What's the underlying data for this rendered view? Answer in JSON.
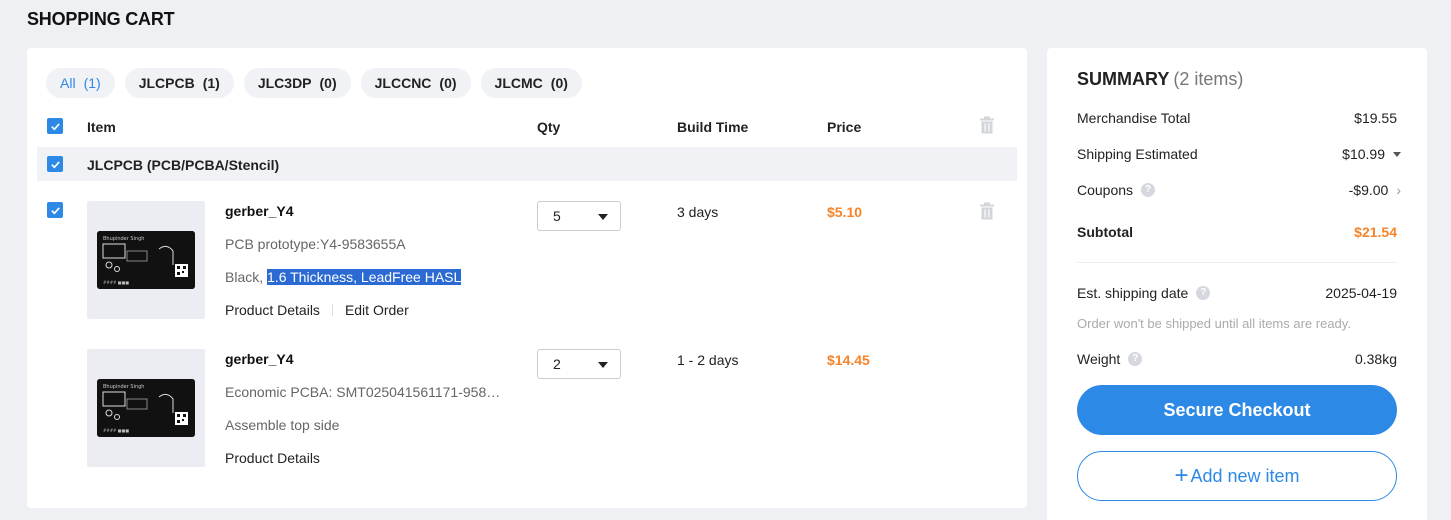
{
  "page_title": "SHOPPING CART",
  "tabs": [
    {
      "label": "All",
      "count": "(1)"
    },
    {
      "label": "JLCPCB",
      "count": "(1)"
    },
    {
      "label": "JLC3DP",
      "count": "(0)"
    },
    {
      "label": "JLCCNC",
      "count": "(0)"
    },
    {
      "label": "JLCMC",
      "count": "(0)"
    }
  ],
  "columns": {
    "item": "Item",
    "qty": "Qty",
    "build_time": "Build Time",
    "price": "Price"
  },
  "group": {
    "label": "JLCPCB (PCB/PCBA/Stencil)"
  },
  "items": [
    {
      "name": "gerber_Y4",
      "line1": "PCB prototype:Y4-9583655A",
      "line2_plain": "Black, ",
      "line2_highlight": "1.6 Thickness, LeadFree HASL",
      "qty": "5",
      "build_time": "3 days",
      "price": "$5.10",
      "link1": "Product Details",
      "link2": "Edit Order"
    },
    {
      "name": "gerber_Y4",
      "line1": "Economic PCBA: SMT025041561171-958…",
      "line2": "Assemble top side",
      "qty": "2",
      "build_time": "1 - 2 days",
      "price": "$14.45",
      "link1": "Product Details"
    }
  ],
  "summary": {
    "title": "SUMMARY",
    "items_count": "(2 items)",
    "merch_label": "Merchandise Total",
    "merch_value": "$19.55",
    "shipping_label": "Shipping Estimated",
    "shipping_value": "$10.99",
    "coupons_label": "Coupons",
    "coupons_value": "-$9.00",
    "subtotal_label": "Subtotal",
    "subtotal_value": "$21.54",
    "ship_date_label": "Est. shipping date",
    "ship_date_value": "2025-04-19",
    "note": "Order won't be shipped until all items are ready.",
    "weight_label": "Weight",
    "weight_value": "0.38kg",
    "checkout_label": "Secure Checkout",
    "add_label": "Add new item"
  },
  "colors": {
    "accent": "#2d89e6",
    "price": "#f5842b",
    "highlight": "#2a6ad2"
  }
}
